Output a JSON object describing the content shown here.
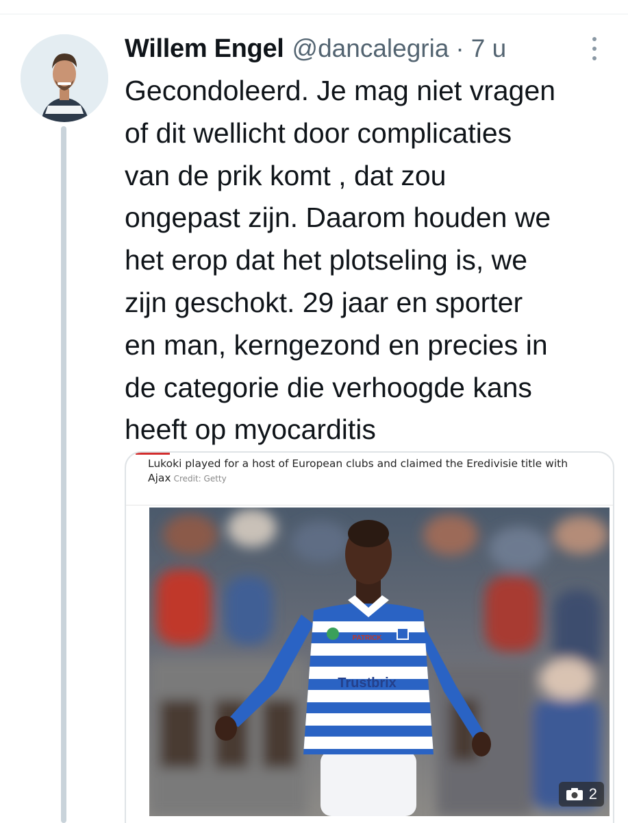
{
  "tweet": {
    "author_name": "Willem Engel",
    "author_handle": "@dancalegria",
    "separator": "·",
    "time": "7 u",
    "text_lines": [
      "Gecondoleerd. Je mag niet vragen",
      "of dit wellicht door complicaties",
      "van de prik komt , dat zou",
      "ongepast zijn. Daarom houden we",
      "het erop dat het plotseling is, we",
      "zijn geschokt. 29 jaar en sporter",
      "en man, kerngezond en precies in",
      "de categorie die verhoogde kans",
      "heeft op myocarditis"
    ]
  },
  "media": {
    "caption": "Lukoki played for a host of European clubs and claimed the Eredivisie title with Ajax",
    "credit": "Credit: Getty",
    "jersey_brand": "PATRICK",
    "jersey_sponsor": "Trustbrix",
    "photo_count": "2"
  },
  "icons": {
    "more": "more-vertical-icon",
    "camera": "camera-icon"
  },
  "colors": {
    "text": "#0f1419",
    "secondary": "#536471",
    "thread_line": "#c9d3da",
    "jersey_blue": "#2a63c4"
  }
}
